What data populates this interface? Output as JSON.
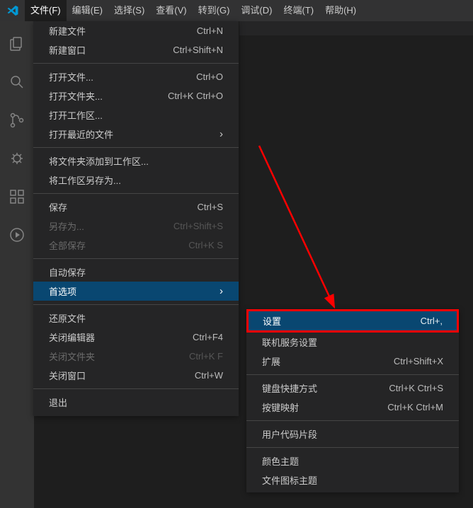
{
  "menubar": {
    "items": [
      {
        "label": "文件(F)"
      },
      {
        "label": "编辑(E)"
      },
      {
        "label": "选择(S)"
      },
      {
        "label": "查看(V)"
      },
      {
        "label": "转到(G)"
      },
      {
        "label": "调试(D)"
      },
      {
        "label": "终端(T)"
      },
      {
        "label": "帮助(H)"
      }
    ]
  },
  "file_menu": {
    "items": [
      {
        "label": "新建文件",
        "shortcut": "Ctrl+N"
      },
      {
        "label": "新建窗口",
        "shortcut": "Ctrl+Shift+N"
      },
      {
        "sep": true
      },
      {
        "label": "打开文件...",
        "shortcut": "Ctrl+O"
      },
      {
        "label": "打开文件夹...",
        "shortcut": "Ctrl+K Ctrl+O"
      },
      {
        "label": "打开工作区..."
      },
      {
        "label": "打开最近的文件",
        "submenu": true
      },
      {
        "sep": true
      },
      {
        "label": "将文件夹添加到工作区..."
      },
      {
        "label": "将工作区另存为..."
      },
      {
        "sep": true
      },
      {
        "label": "保存",
        "shortcut": "Ctrl+S"
      },
      {
        "label": "另存为...",
        "shortcut": "Ctrl+Shift+S",
        "disabled": true
      },
      {
        "label": "全部保存",
        "shortcut": "Ctrl+K S",
        "disabled": true
      },
      {
        "sep": true
      },
      {
        "label": "自动保存"
      },
      {
        "label": "首选项",
        "submenu": true,
        "highlight": true
      },
      {
        "sep": true
      },
      {
        "label": "还原文件"
      },
      {
        "label": "关闭编辑器",
        "shortcut": "Ctrl+F4"
      },
      {
        "label": "关闭文件夹",
        "shortcut": "Ctrl+K F",
        "disabled": true
      },
      {
        "label": "关闭窗口",
        "shortcut": "Ctrl+W"
      },
      {
        "sep": true
      },
      {
        "label": "退出"
      }
    ]
  },
  "pref_submenu": {
    "items": [
      {
        "label": "设置",
        "shortcut": "Ctrl+,",
        "highlight_boxed": true
      },
      {
        "label": "联机服务设置"
      },
      {
        "label": "扩展",
        "shortcut": "Ctrl+Shift+X"
      },
      {
        "sep": true
      },
      {
        "label": "键盘快捷方式",
        "shortcut": "Ctrl+K Ctrl+S"
      },
      {
        "label": "按键映射",
        "shortcut": "Ctrl+K Ctrl+M"
      },
      {
        "sep": true
      },
      {
        "label": "用户代码片段"
      },
      {
        "sep": true
      },
      {
        "label": "颜色主题"
      },
      {
        "label": "文件图标主题"
      }
    ]
  }
}
